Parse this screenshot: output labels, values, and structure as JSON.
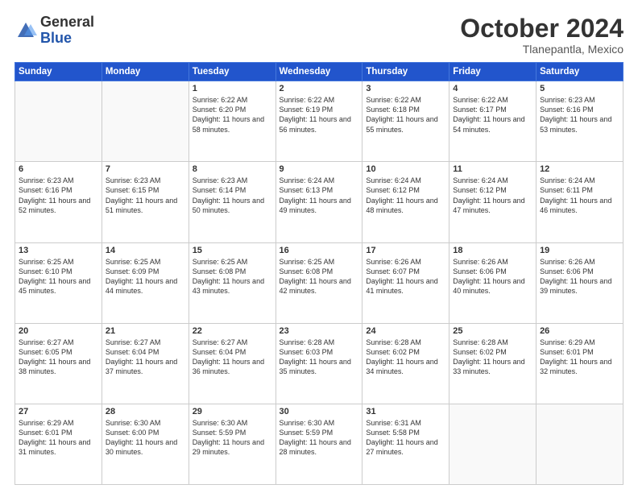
{
  "header": {
    "logo_general": "General",
    "logo_blue": "Blue",
    "month_title": "October 2024",
    "location": "Tlanepantla, Mexico"
  },
  "weekdays": [
    "Sunday",
    "Monday",
    "Tuesday",
    "Wednesday",
    "Thursday",
    "Friday",
    "Saturday"
  ],
  "weeks": [
    [
      {
        "day": "",
        "info": ""
      },
      {
        "day": "",
        "info": ""
      },
      {
        "day": "1",
        "info": "Sunrise: 6:22 AM\nSunset: 6:20 PM\nDaylight: 11 hours and 58 minutes."
      },
      {
        "day": "2",
        "info": "Sunrise: 6:22 AM\nSunset: 6:19 PM\nDaylight: 11 hours and 56 minutes."
      },
      {
        "day": "3",
        "info": "Sunrise: 6:22 AM\nSunset: 6:18 PM\nDaylight: 11 hours and 55 minutes."
      },
      {
        "day": "4",
        "info": "Sunrise: 6:22 AM\nSunset: 6:17 PM\nDaylight: 11 hours and 54 minutes."
      },
      {
        "day": "5",
        "info": "Sunrise: 6:23 AM\nSunset: 6:16 PM\nDaylight: 11 hours and 53 minutes."
      }
    ],
    [
      {
        "day": "6",
        "info": "Sunrise: 6:23 AM\nSunset: 6:16 PM\nDaylight: 11 hours and 52 minutes."
      },
      {
        "day": "7",
        "info": "Sunrise: 6:23 AM\nSunset: 6:15 PM\nDaylight: 11 hours and 51 minutes."
      },
      {
        "day": "8",
        "info": "Sunrise: 6:23 AM\nSunset: 6:14 PM\nDaylight: 11 hours and 50 minutes."
      },
      {
        "day": "9",
        "info": "Sunrise: 6:24 AM\nSunset: 6:13 PM\nDaylight: 11 hours and 49 minutes."
      },
      {
        "day": "10",
        "info": "Sunrise: 6:24 AM\nSunset: 6:12 PM\nDaylight: 11 hours and 48 minutes."
      },
      {
        "day": "11",
        "info": "Sunrise: 6:24 AM\nSunset: 6:12 PM\nDaylight: 11 hours and 47 minutes."
      },
      {
        "day": "12",
        "info": "Sunrise: 6:24 AM\nSunset: 6:11 PM\nDaylight: 11 hours and 46 minutes."
      }
    ],
    [
      {
        "day": "13",
        "info": "Sunrise: 6:25 AM\nSunset: 6:10 PM\nDaylight: 11 hours and 45 minutes."
      },
      {
        "day": "14",
        "info": "Sunrise: 6:25 AM\nSunset: 6:09 PM\nDaylight: 11 hours and 44 minutes."
      },
      {
        "day": "15",
        "info": "Sunrise: 6:25 AM\nSunset: 6:08 PM\nDaylight: 11 hours and 43 minutes."
      },
      {
        "day": "16",
        "info": "Sunrise: 6:25 AM\nSunset: 6:08 PM\nDaylight: 11 hours and 42 minutes."
      },
      {
        "day": "17",
        "info": "Sunrise: 6:26 AM\nSunset: 6:07 PM\nDaylight: 11 hours and 41 minutes."
      },
      {
        "day": "18",
        "info": "Sunrise: 6:26 AM\nSunset: 6:06 PM\nDaylight: 11 hours and 40 minutes."
      },
      {
        "day": "19",
        "info": "Sunrise: 6:26 AM\nSunset: 6:06 PM\nDaylight: 11 hours and 39 minutes."
      }
    ],
    [
      {
        "day": "20",
        "info": "Sunrise: 6:27 AM\nSunset: 6:05 PM\nDaylight: 11 hours and 38 minutes."
      },
      {
        "day": "21",
        "info": "Sunrise: 6:27 AM\nSunset: 6:04 PM\nDaylight: 11 hours and 37 minutes."
      },
      {
        "day": "22",
        "info": "Sunrise: 6:27 AM\nSunset: 6:04 PM\nDaylight: 11 hours and 36 minutes."
      },
      {
        "day": "23",
        "info": "Sunrise: 6:28 AM\nSunset: 6:03 PM\nDaylight: 11 hours and 35 minutes."
      },
      {
        "day": "24",
        "info": "Sunrise: 6:28 AM\nSunset: 6:02 PM\nDaylight: 11 hours and 34 minutes."
      },
      {
        "day": "25",
        "info": "Sunrise: 6:28 AM\nSunset: 6:02 PM\nDaylight: 11 hours and 33 minutes."
      },
      {
        "day": "26",
        "info": "Sunrise: 6:29 AM\nSunset: 6:01 PM\nDaylight: 11 hours and 32 minutes."
      }
    ],
    [
      {
        "day": "27",
        "info": "Sunrise: 6:29 AM\nSunset: 6:01 PM\nDaylight: 11 hours and 31 minutes."
      },
      {
        "day": "28",
        "info": "Sunrise: 6:30 AM\nSunset: 6:00 PM\nDaylight: 11 hours and 30 minutes."
      },
      {
        "day": "29",
        "info": "Sunrise: 6:30 AM\nSunset: 5:59 PM\nDaylight: 11 hours and 29 minutes."
      },
      {
        "day": "30",
        "info": "Sunrise: 6:30 AM\nSunset: 5:59 PM\nDaylight: 11 hours and 28 minutes."
      },
      {
        "day": "31",
        "info": "Sunrise: 6:31 AM\nSunset: 5:58 PM\nDaylight: 11 hours and 27 minutes."
      },
      {
        "day": "",
        "info": ""
      },
      {
        "day": "",
        "info": ""
      }
    ]
  ]
}
